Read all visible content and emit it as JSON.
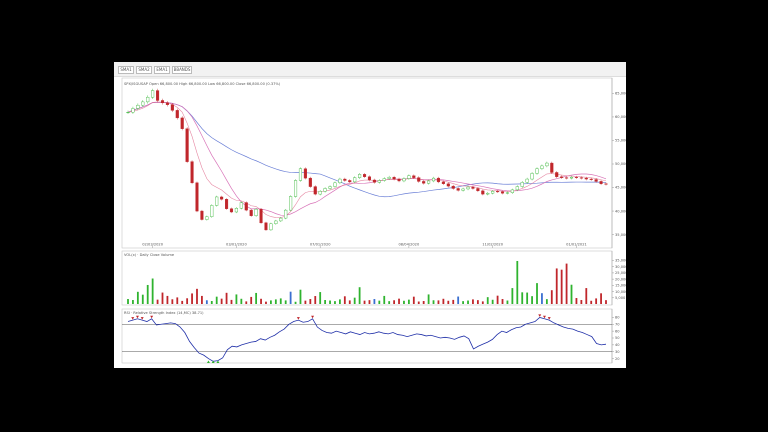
{
  "window": {
    "background": "#000000",
    "panel_background": "#ffffff"
  },
  "legend_buttons": [
    {
      "label": "SMA1",
      "color": "#7b7bd6"
    },
    {
      "label": "SMA2",
      "color": "#d66bb0"
    },
    {
      "label": "EMA1",
      "color": "#d47070"
    },
    {
      "label": "BBANDS",
      "color": "#5cbf5c"
    }
  ],
  "price_panel": {
    "header": "SPX/ISGUSAP  Open 66,800.00  High 66,800.00  Low 66,800.00  Close 66,800.00 (0.37%)",
    "colors": {
      "up": "#2fb32f",
      "down": "#c0262b",
      "sma_long": "#6a7fd6",
      "sma_short": "#d873b8",
      "ema": "#e06a8c"
    }
  },
  "volume_panel": {
    "header": "VOL(x)  ·  Daily Close Volume"
  },
  "rsi_panel": {
    "header": "RSI  ·  Relative Strength Index (14,MC) 38.71)"
  },
  "chart_data": [
    {
      "type": "candlestick",
      "title": "",
      "x_tick_labels": [
        "02/03/2020",
        "03/01/2020",
        "07/01/2020",
        "08/04/2020",
        "11/02/2020",
        "01/01/2021"
      ],
      "y_tick_labels": [
        "65,000",
        "60,000",
        "55,000",
        "50,000",
        "45,000",
        "40,000",
        "35,000"
      ],
      "ylim": [
        33000,
        67000
      ],
      "close": [
        61000,
        61800,
        62500,
        63200,
        64200,
        65600,
        63500,
        63000,
        62600,
        61400,
        59800,
        57500,
        50500,
        46000,
        40000,
        38200,
        38800,
        41200,
        43000,
        42500,
        40500,
        39800,
        40600,
        41800,
        40200,
        39000,
        40400,
        37500,
        36000,
        37300,
        37900,
        38500,
        40200,
        43100,
        46500,
        49000,
        47000,
        45200,
        43600,
        44200,
        44800,
        45200,
        46000,
        46800,
        46500,
        46200,
        47100,
        47800,
        47300,
        46600,
        46100,
        46500,
        46900,
        47200,
        46800,
        46400,
        46900,
        47500,
        47100,
        46300,
        45900,
        46400,
        47000,
        46200,
        45800,
        45300,
        44800,
        44400,
        44700,
        45100,
        44800,
        44300,
        43600,
        43800,
        44200,
        44100,
        43800,
        43900,
        44500,
        45200,
        46100,
        46800,
        48000,
        49000,
        49600,
        50200,
        48200,
        47300,
        47100,
        47000,
        47200,
        47100,
        47000,
        46800,
        46700,
        46300,
        45800,
        45700
      ]
    },
    {
      "type": "bar",
      "title": "",
      "y_tick_labels": [
        "35,000",
        "30,000",
        "25,000",
        "20,000",
        "15,000",
        "10,000",
        "5,000"
      ],
      "ylim": [
        0,
        37000
      ],
      "values": [
        4000,
        3200,
        9800,
        7500,
        15300,
        20500,
        3500,
        9200,
        6500,
        3800,
        5300,
        2500,
        4600,
        8500,
        12200,
        6500,
        3000,
        2400,
        5900,
        4300,
        9000,
        3300,
        7700,
        4200,
        2100,
        5700,
        8900,
        4200,
        1900,
        2900,
        3700,
        4500,
        2900,
        9900,
        1800,
        11500,
        2700,
        4000,
        6400,
        9600,
        3200,
        2800,
        2300,
        3700,
        6200,
        2900,
        5100,
        13500,
        2700,
        3100,
        4000,
        2700,
        6500,
        2300,
        3000,
        4300,
        2600,
        3500,
        5900,
        2000,
        2400,
        7700,
        3000,
        2900,
        4200,
        2600,
        3300,
        6000,
        2300,
        2800,
        3700,
        3100,
        2100,
        5500,
        3400,
        6700,
        4000,
        2800,
        12800,
        34600,
        9400,
        9200,
        6300,
        16800,
        8700,
        3900,
        11100,
        28600,
        27600,
        32500,
        15500,
        4800,
        3200,
        12800,
        2600,
        4500,
        8600,
        3100
      ]
    },
    {
      "type": "line",
      "title": "",
      "y_tick_labels": [
        "80",
        "70",
        "60",
        "50",
        "40",
        "30",
        "20"
      ],
      "ylim": [
        15,
        85
      ],
      "values": [
        74,
        76,
        78,
        76,
        74,
        78,
        69,
        70,
        71,
        72,
        71,
        66,
        58,
        45,
        36,
        28,
        25,
        20,
        16,
        17,
        21,
        33,
        38,
        37,
        40,
        42,
        44,
        45,
        49,
        47,
        51,
        54,
        59,
        63,
        70,
        74,
        76,
        73,
        74,
        78,
        66,
        61,
        58,
        57,
        60,
        58,
        56,
        59,
        57,
        55,
        58,
        56,
        57,
        59,
        57,
        56,
        58,
        55,
        54,
        52,
        54,
        56,
        55,
        53,
        54,
        52,
        50,
        51,
        50,
        48,
        51,
        53,
        49,
        34,
        38,
        41,
        44,
        48,
        55,
        60,
        58,
        62,
        65,
        66,
        70,
        72,
        74,
        80,
        78,
        76,
        72,
        69,
        66,
        64,
        63,
        60,
        58,
        55,
        52,
        42,
        40,
        41
      ]
    }
  ]
}
